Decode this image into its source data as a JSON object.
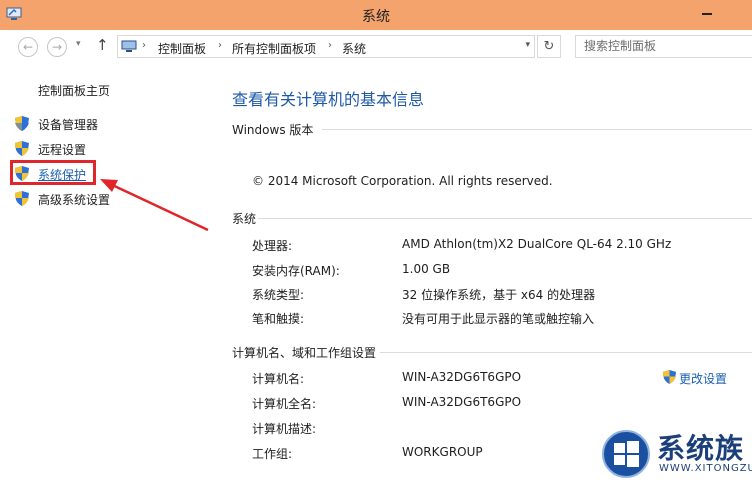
{
  "window": {
    "title": "系统"
  },
  "nav": {
    "back_glyph": "←",
    "forward_glyph": "→",
    "dropdown_glyph": "▾",
    "up_glyph": "↑",
    "refresh_glyph": "↻",
    "breadcrumb": [
      "控制面板",
      "所有控制面板项",
      "系统"
    ],
    "breadcrumb_sep": "›",
    "search_placeholder": "搜索控制面板"
  },
  "sidebar": {
    "home": "控制面板主页",
    "items": [
      {
        "label": "设备管理器",
        "icon": "uac-shield-icon"
      },
      {
        "label": "远程设置",
        "icon": "uac-shield-icon"
      },
      {
        "label": "系统保护",
        "icon": "uac-shield-icon",
        "highlighted": true
      },
      {
        "label": "高级系统设置",
        "icon": "uac-shield-icon"
      }
    ]
  },
  "main": {
    "heading": "查看有关计算机的基本信息",
    "windows_edition": {
      "title": "Windows 版本",
      "copyright": "© 2014 Microsoft Corporation. All rights reserved."
    },
    "system": {
      "title": "系统",
      "rows": [
        {
          "label": "处理器:",
          "value": "AMD Athlon(tm)X2 DualCore QL-64   2.10 GHz"
        },
        {
          "label": "安装内存(RAM):",
          "value": "1.00 GB"
        },
        {
          "label": "系统类型:",
          "value": "32 位操作系统，基于 x64 的处理器"
        },
        {
          "label": "笔和触摸:",
          "value": "没有可用于此显示器的笔或触控输入"
        }
      ]
    },
    "computer": {
      "title": "计算机名、域和工作组设置",
      "change_settings": "更改设置",
      "rows": [
        {
          "label": "计算机名:",
          "value": "WIN-A32DG6T6GPO"
        },
        {
          "label": "计算机全名:",
          "value": "WIN-A32DG6T6GPO"
        },
        {
          "label": "计算机描述:",
          "value": ""
        },
        {
          "label": "工作组:",
          "value": "WORKGROUP"
        }
      ]
    }
  },
  "watermark": {
    "text_cn": "系统族",
    "text_en": "WWW.XITONGZU.COM"
  },
  "colors": {
    "titlebar": "#f4a36c",
    "heading": "#1d59a8",
    "link": "#1a5fb4",
    "highlight": "#e0262a"
  }
}
